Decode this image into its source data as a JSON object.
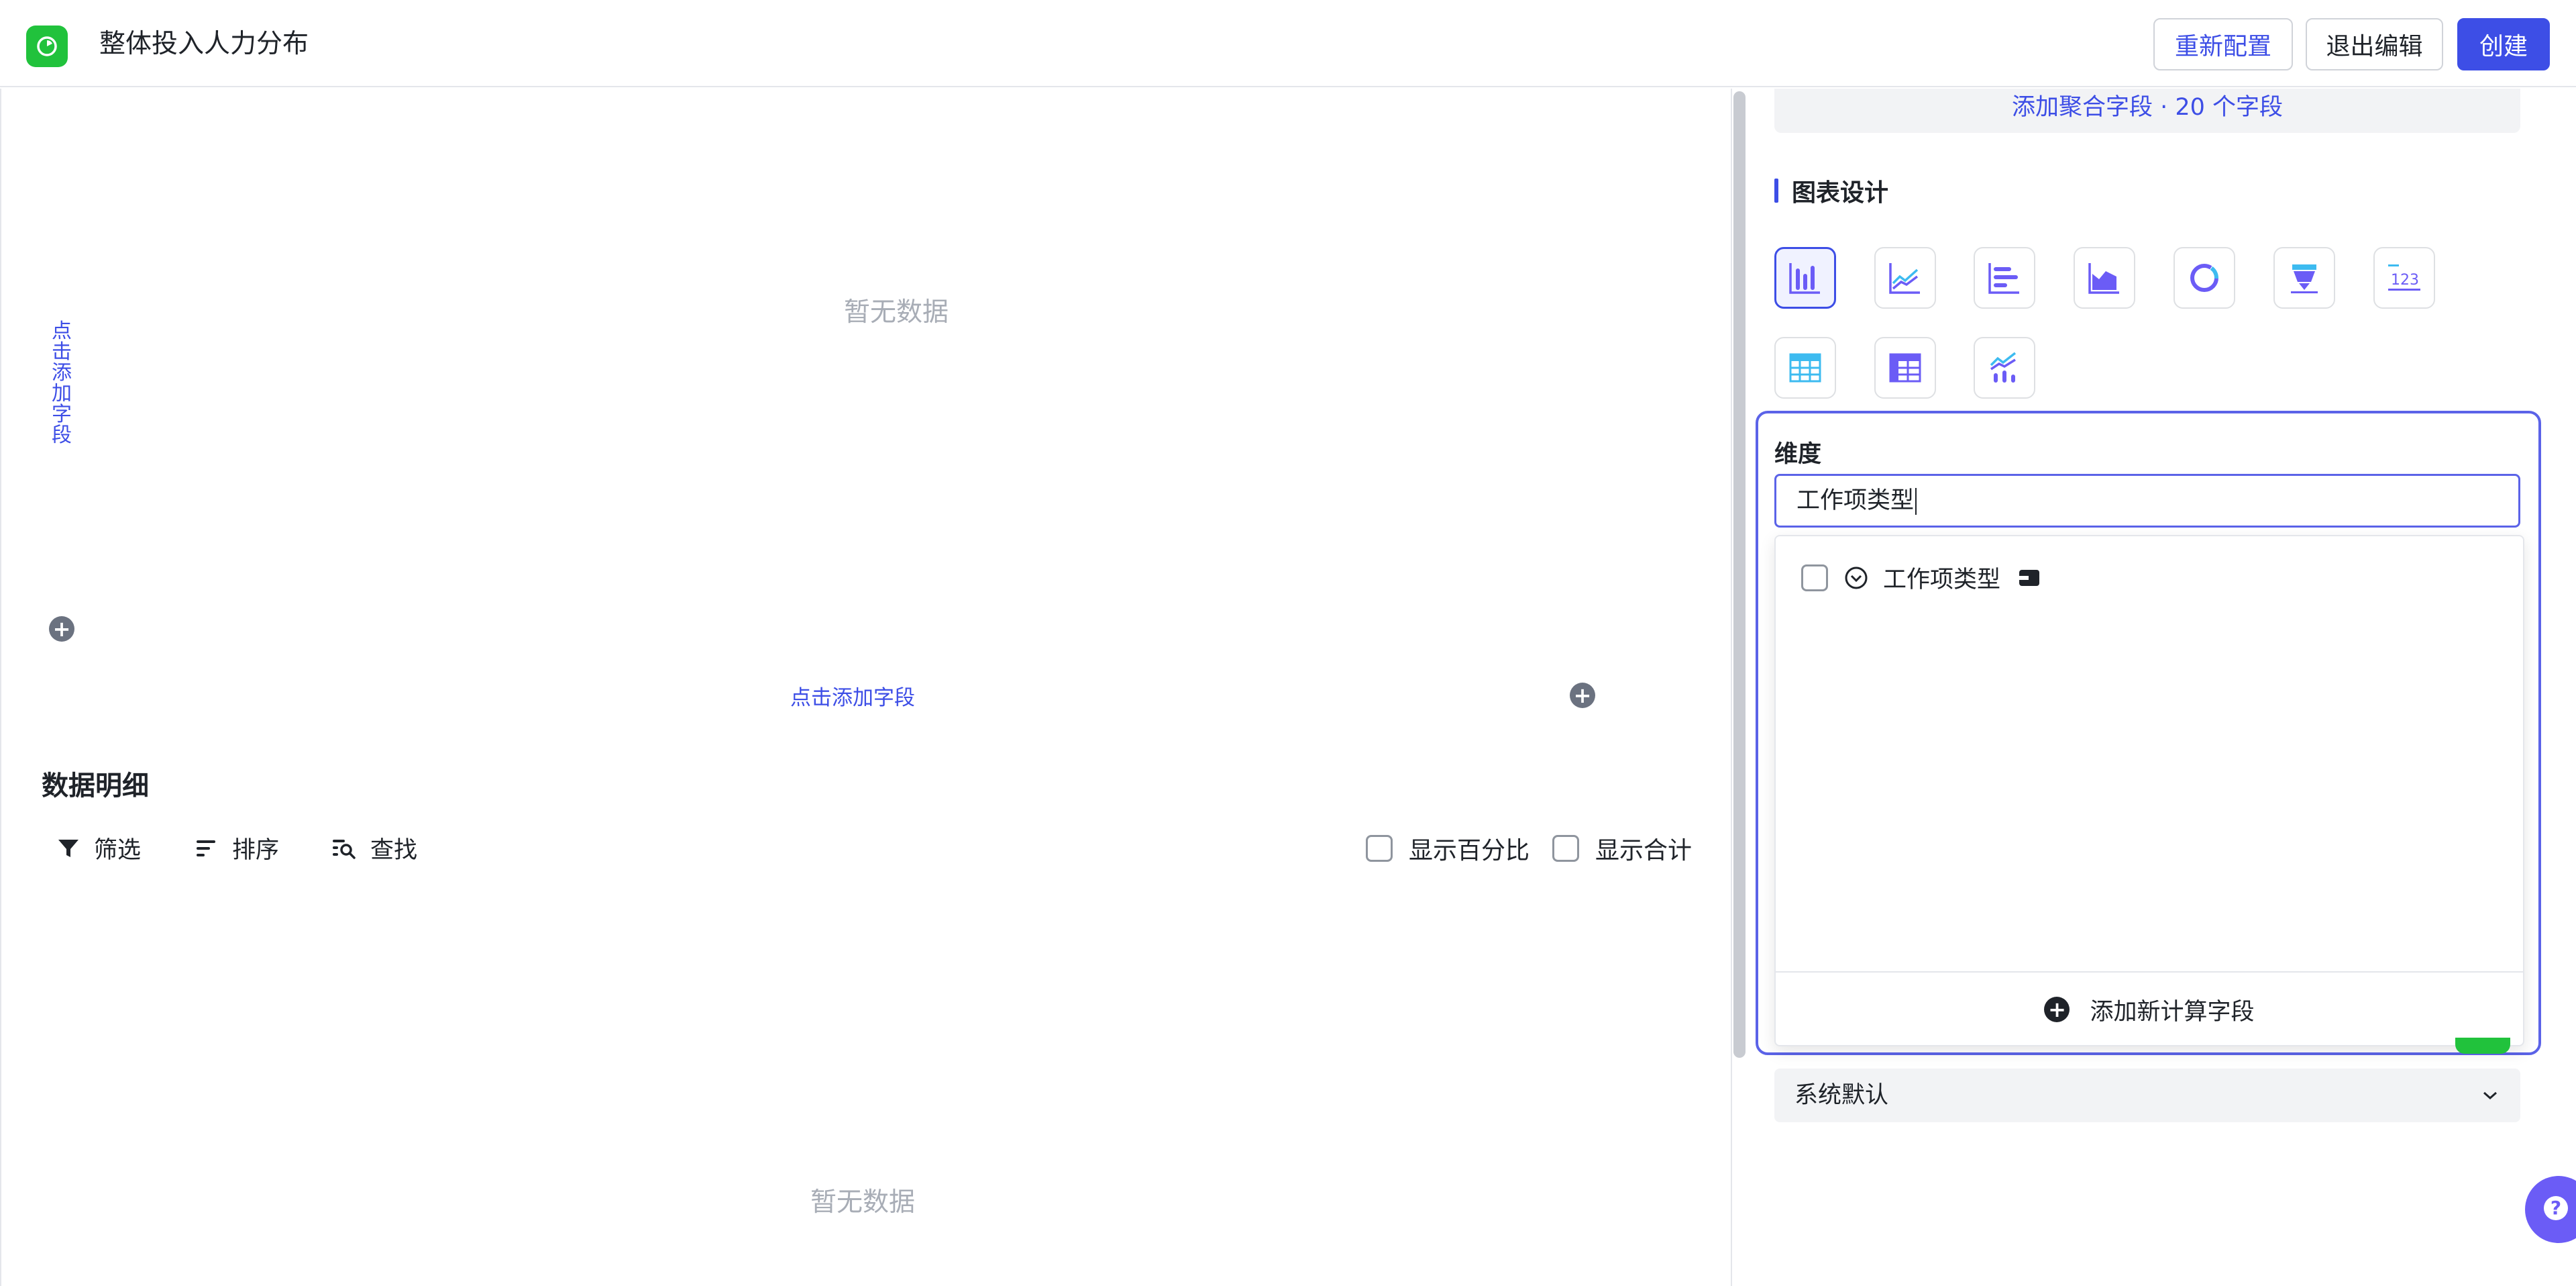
{
  "header": {
    "title": "整体投入人力分布",
    "reconfigure_label": "重新配置",
    "exit_edit_label": "退出编辑",
    "create_label": "创建"
  },
  "canvas": {
    "empty_top": "暂无数据",
    "y_axis_add": "点击添加字段",
    "x_axis_add": "点击添加字段",
    "detail_title": "数据明细",
    "tools": {
      "filter": "筛选",
      "sort": "排序",
      "find": "查找"
    },
    "show_percent": "显示百分比",
    "show_total": "显示合计",
    "empty_bottom": "暂无数据"
  },
  "panel": {
    "add_agg_field": "添加聚合字段 · 20 个字段",
    "chart_design_title": "图表设计",
    "chart_types": [
      {
        "icon": "bar-chart-icon",
        "selected": true
      },
      {
        "icon": "line-chart-icon",
        "selected": false
      },
      {
        "icon": "horizontal-bar-icon",
        "selected": false
      },
      {
        "icon": "area-chart-icon",
        "selected": false
      },
      {
        "icon": "donut-chart-icon",
        "selected": false
      },
      {
        "icon": "funnel-icon",
        "selected": false
      },
      {
        "icon": "number-card-icon",
        "selected": false
      },
      {
        "icon": "table-icon",
        "selected": false
      },
      {
        "icon": "pivot-table-icon",
        "selected": false
      },
      {
        "icon": "combo-chart-icon",
        "selected": false
      }
    ],
    "dimension_label": "维度",
    "dimension_search_value": "工作项类型",
    "options": [
      {
        "label": "工作项类型",
        "checked": false
      }
    ],
    "add_calc_field": "添加新计算字段",
    "system_default": "系统默认"
  },
  "colors": {
    "accent": "#3d4ee6",
    "logo_green": "#21c23c",
    "help_purple": "#6b5cf6",
    "muted_text": "#a8adb6"
  }
}
